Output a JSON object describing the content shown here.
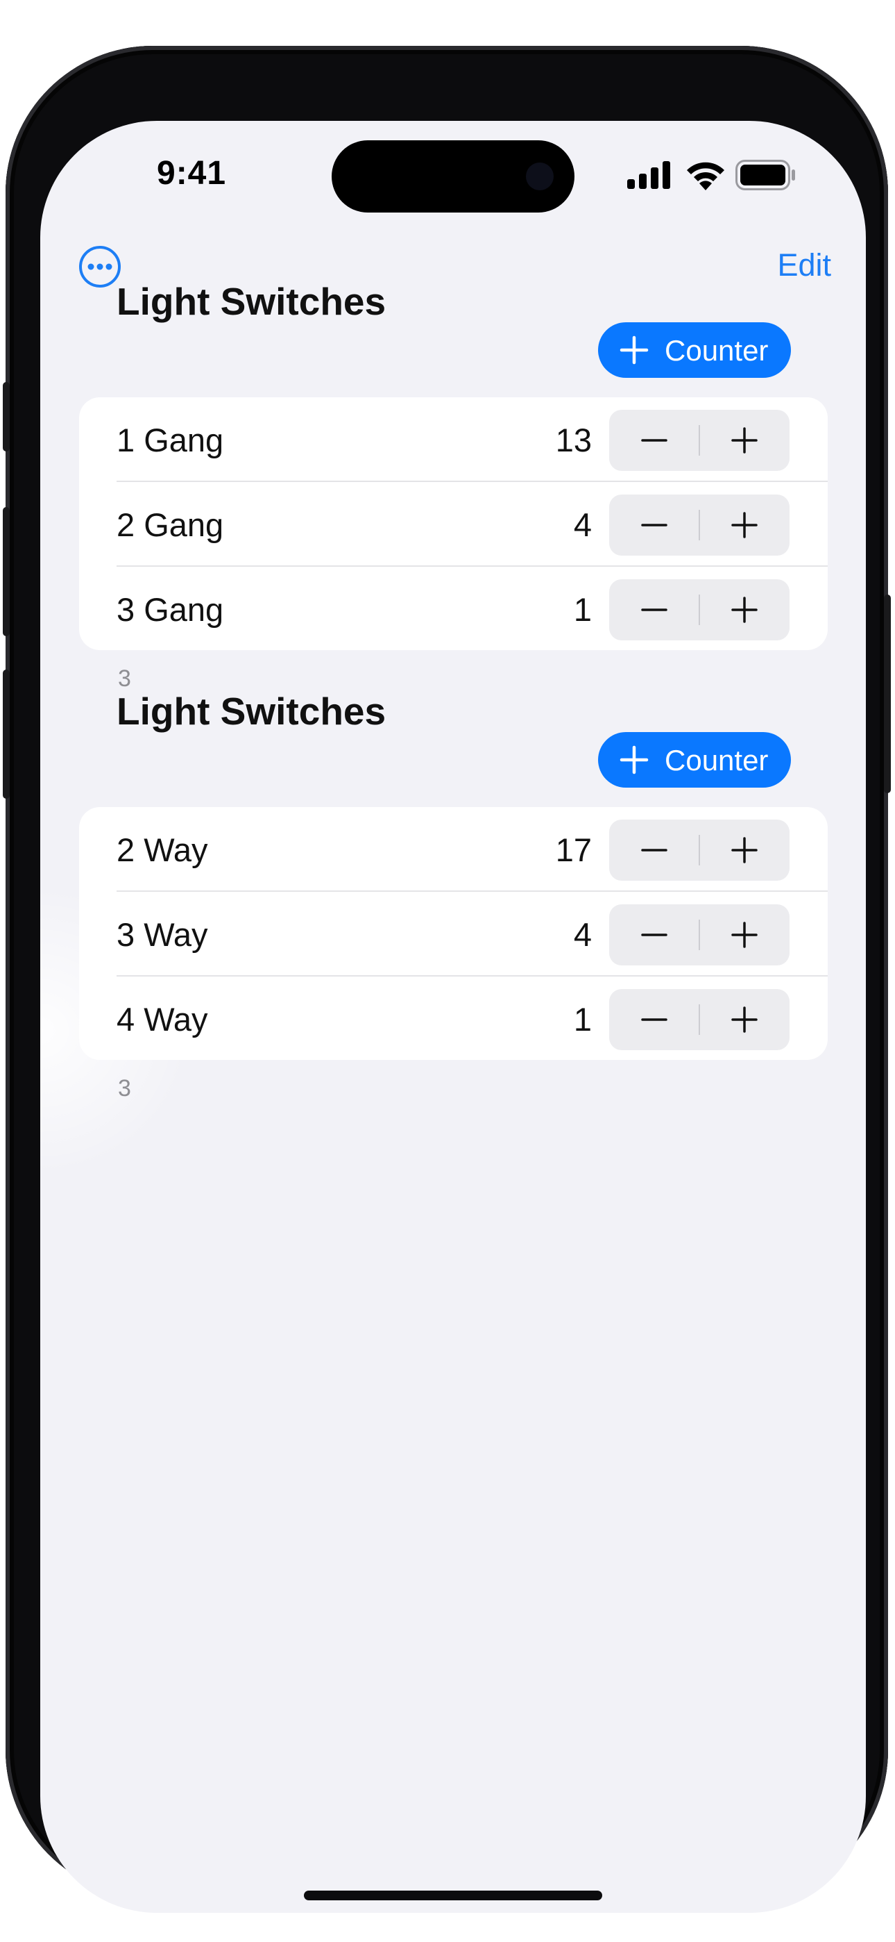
{
  "status_bar": {
    "time": "9:41"
  },
  "nav": {
    "edit_label": "Edit",
    "more_icon": "ellipsis-circle-icon"
  },
  "sections": [
    {
      "title": "Light Switches",
      "add_button_label": "Counter",
      "rows": [
        {
          "name": "1 Gang",
          "count": "13"
        },
        {
          "name": "2 Gang",
          "count": "4"
        },
        {
          "name": "3 Gang",
          "count": "1"
        }
      ],
      "footer": "3"
    },
    {
      "title": "Light Switches",
      "add_button_label": "Counter",
      "rows": [
        {
          "name": "2 Way",
          "count": "17"
        },
        {
          "name": "3 Way",
          "count": "4"
        },
        {
          "name": "4 Way",
          "count": "1"
        }
      ],
      "footer": "3"
    }
  ],
  "colors": {
    "accent": "#0a78ff",
    "link": "#1d7ef5",
    "background": "#f2f2f7",
    "card": "#ffffff"
  }
}
